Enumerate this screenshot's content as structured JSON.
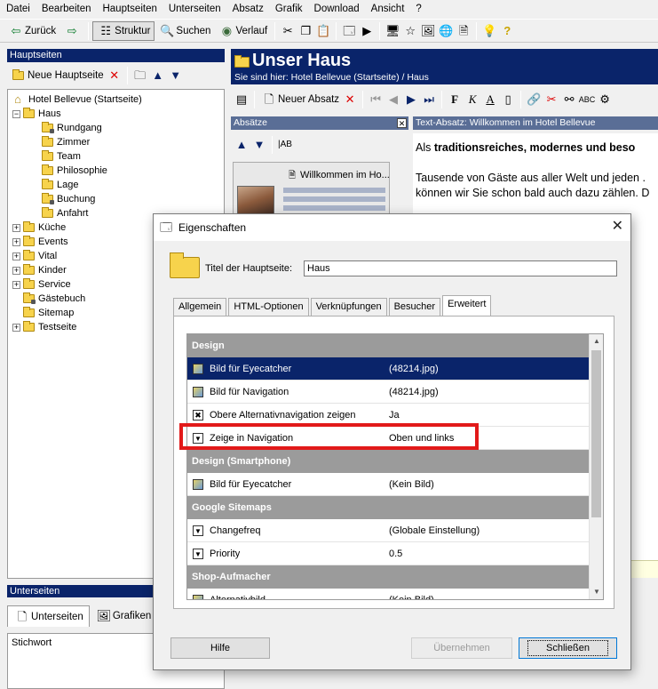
{
  "menu": [
    "Datei",
    "Bearbeiten",
    "Hauptseiten",
    "Unterseiten",
    "Absatz",
    "Grafik",
    "Download",
    "Ansicht",
    "?"
  ],
  "toolbar": {
    "back_label": "Zurück",
    "structure_label": "Struktur",
    "search_label": "Suchen",
    "history_label": "Verlauf"
  },
  "left_panel": {
    "header": "Hauptseiten",
    "new_page_label": "Neue Hauptseite",
    "tree": [
      {
        "label": "Hotel Bellevue (Startseite)",
        "level": 0,
        "expander": "",
        "icon": "home"
      },
      {
        "label": "Haus",
        "level": 1,
        "expander": "−",
        "icon": "folder"
      },
      {
        "label": "Rundgang",
        "level": 2,
        "expander": "",
        "icon": "folder-lock"
      },
      {
        "label": "Zimmer",
        "level": 2,
        "expander": "",
        "icon": "folder"
      },
      {
        "label": "Team",
        "level": 2,
        "expander": "",
        "icon": "folder"
      },
      {
        "label": "Philosophie",
        "level": 2,
        "expander": "",
        "icon": "folder"
      },
      {
        "label": "Lage",
        "level": 2,
        "expander": "",
        "icon": "folder"
      },
      {
        "label": "Buchung",
        "level": 2,
        "expander": "",
        "icon": "folder-lock"
      },
      {
        "label": "Anfahrt",
        "level": 2,
        "expander": "",
        "icon": "folder"
      },
      {
        "label": "Küche",
        "level": 1,
        "expander": "+",
        "icon": "folder"
      },
      {
        "label": "Events",
        "level": 1,
        "expander": "+",
        "icon": "folder"
      },
      {
        "label": "Vital",
        "level": 1,
        "expander": "+",
        "icon": "folder"
      },
      {
        "label": "Kinder",
        "level": 1,
        "expander": "+",
        "icon": "folder"
      },
      {
        "label": "Service",
        "level": 1,
        "expander": "+",
        "icon": "folder"
      },
      {
        "label": "Gästebuch",
        "level": 1,
        "expander": "",
        "icon": "folder-lock"
      },
      {
        "label": "Sitemap",
        "level": 1,
        "expander": "",
        "icon": "folder"
      },
      {
        "label": "Testseite",
        "level": 1,
        "expander": "+",
        "icon": "folder"
      }
    ]
  },
  "bottom_panel": {
    "header": "Unterseiten",
    "tab_subpages": "Unterseiten",
    "tab_graphics": "Grafiken",
    "keyword_label": "Stichwort"
  },
  "page": {
    "title": "Unser Haus",
    "breadcrumb": "Sie sind hier: Hotel Bellevue (Startseite) / Haus",
    "new_paragraph_label": "Neuer Absatz"
  },
  "paragraphs": {
    "header": "Absätze",
    "item_title": "Willkommen im Ho..."
  },
  "text_editor": {
    "header": "Text-Absatz: Willkommen im Hotel Bellevue",
    "line1_prefix": "Als ",
    "line1_bold": "traditionsreiches, modernes und beso",
    "line2": "Tausende von Gäste aus aller Welt und jeden .",
    "line3": "können wir Sie schon bald auch dazu zählen. D"
  },
  "dialog": {
    "title": "Eigenschaften",
    "field_label": "Titel der Hauptseite:",
    "field_value": "Haus",
    "tabs": [
      "Allgemein",
      "HTML-Optionen",
      "Verknüpfungen",
      "Besucher",
      "Erweitert"
    ],
    "active_tab": "Erweitert",
    "rows": [
      {
        "type": "section",
        "name": "Design"
      },
      {
        "type": "item",
        "icon": "img",
        "name": "Bild für Eyecatcher",
        "value": "(48214.jpg)",
        "selected": true
      },
      {
        "type": "item",
        "icon": "img",
        "name": "Bild für Navigation",
        "value": "(48214.jpg)"
      },
      {
        "type": "item",
        "icon": "chk",
        "name": "Obere Alternativnavigation zeigen",
        "value": "Ja"
      },
      {
        "type": "item",
        "icon": "drop",
        "name": "Zeige in Navigation",
        "value": "Oben und links"
      },
      {
        "type": "section",
        "name": "Design (Smartphone)"
      },
      {
        "type": "item",
        "icon": "img",
        "name": "Bild für Eyecatcher",
        "value": "(Kein Bild)"
      },
      {
        "type": "section",
        "name": "Google Sitemaps"
      },
      {
        "type": "item",
        "icon": "drop",
        "name": "Changefreq",
        "value": "(Globale Einstellung)"
      },
      {
        "type": "item",
        "icon": "drop",
        "name": "Priority",
        "value": "0.5"
      },
      {
        "type": "section",
        "name": "Shop-Aufmacher"
      },
      {
        "type": "item",
        "icon": "img",
        "name": "Alternativbild",
        "value": "(Kein Bild)"
      }
    ],
    "help_label": "Hilfe",
    "apply_label": "Übernehmen",
    "close_label": "Schließen"
  },
  "colors": {
    "title_bar": "#0a246a",
    "selection": "#0a246a",
    "section_row": "#9b9b9b",
    "highlight": "#e21919",
    "folder": "#f7d34c"
  }
}
